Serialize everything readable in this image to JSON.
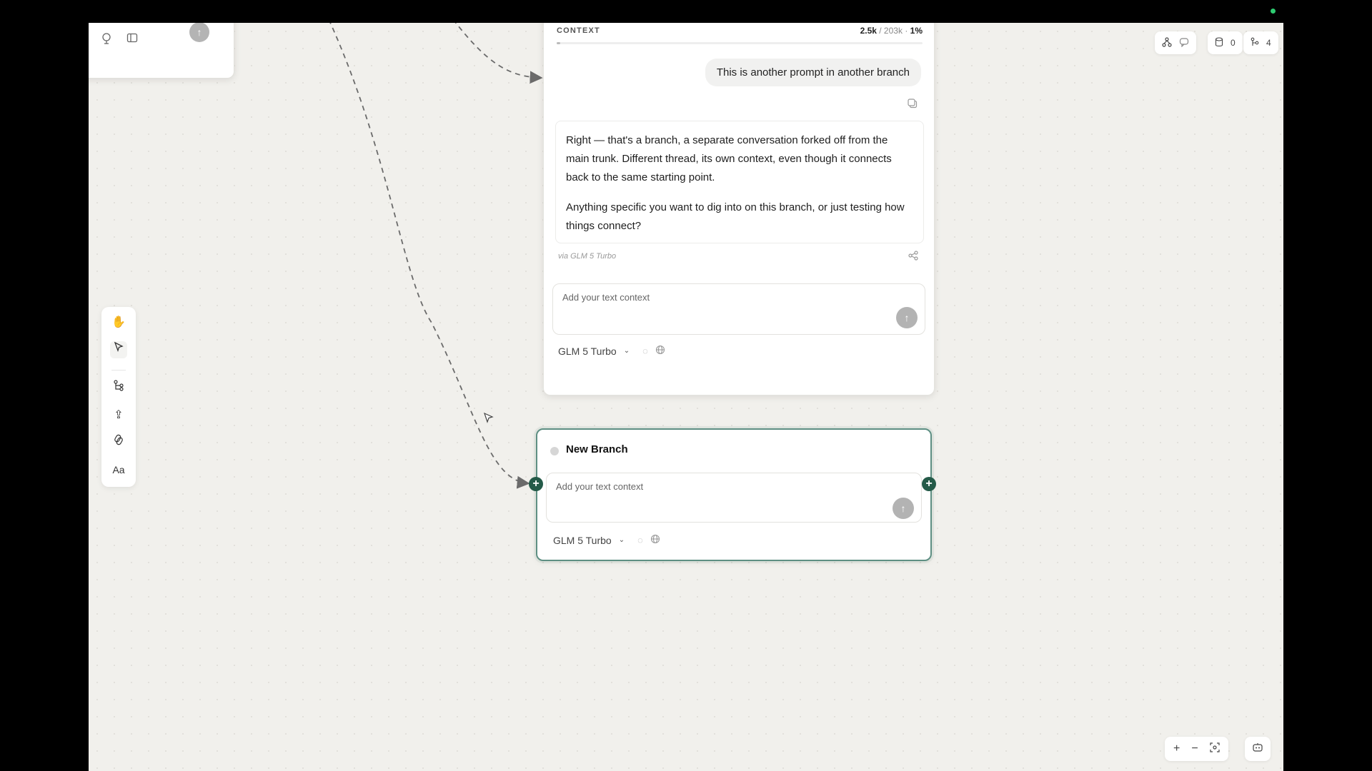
{
  "top_left_panel": {
    "send_icon": "arrow-up-icon",
    "icons": [
      "brain-icon",
      "sidebar-icon"
    ]
  },
  "main_node": {
    "context_label": "CONTEXT",
    "context_used": "2.5k",
    "context_total": "/ 203k",
    "context_separator": "·",
    "context_percent": "1%",
    "context_fraction": 0.01,
    "user_prompt": "This is another prompt in another branch",
    "reply_paragraphs": [
      "Right — that's a branch, a separate conversation forked off from the main trunk. Different thread, its own context, even though it connects back to the same starting point.",
      "Anything specific you want to dig into on this branch, or just testing how things connect?"
    ],
    "via_label": "via GLM 5 Turbo",
    "input_placeholder": "Add your text context",
    "model_label": "GLM 5 Turbo"
  },
  "new_branch_node": {
    "title": "New Branch",
    "input_placeholder": "Add your text context",
    "model_label": "GLM 5 Turbo"
  },
  "toolbar": {
    "tools": [
      "hand-icon",
      "pointer-icon",
      "branch-icon",
      "upload-icon",
      "link-icon",
      "text-icon"
    ],
    "text_tool_label": "Aa"
  },
  "top_right": {
    "icons": [
      "graph-icon",
      "chat-icon"
    ],
    "docs_count": "0",
    "branches_count": "4"
  },
  "bottom_right": {
    "zoom_in": "+",
    "zoom_out": "−",
    "icons": [
      "fit-view-icon",
      "bot-icon"
    ]
  },
  "colors": {
    "accent": "#245a48",
    "node_border": "#5e8f83",
    "canvas": "#f1f0ec"
  }
}
